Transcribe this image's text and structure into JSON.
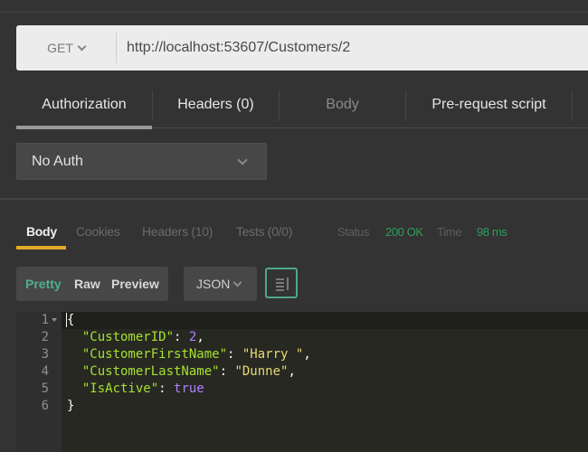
{
  "request": {
    "method": "GET",
    "url": "http://localhost:53607/Customers/2",
    "tabs": [
      {
        "label": "Authorization",
        "active": true,
        "disabled": false
      },
      {
        "label": "Headers (0)",
        "active": false,
        "disabled": false
      },
      {
        "label": "Body",
        "active": false,
        "disabled": true
      },
      {
        "label": "Pre-request script",
        "active": false,
        "disabled": false
      }
    ],
    "auth_type": "No Auth"
  },
  "response": {
    "tabs": [
      {
        "label": "Body",
        "active": true
      },
      {
        "label": "Cookies",
        "active": false
      },
      {
        "label": "Headers (10)",
        "active": false
      },
      {
        "label": "Tests (0/0)",
        "active": false
      }
    ],
    "status_label": "Status",
    "status_value": "200 OK",
    "time_label": "Time",
    "time_value": "98 ms",
    "status_color": "#2f9e5a",
    "view_modes": [
      {
        "label": "Pretty",
        "active": true
      },
      {
        "label": "Raw",
        "active": false
      },
      {
        "label": "Preview",
        "active": false
      }
    ],
    "format": "JSON",
    "wrap_icon": "wrap-lines-icon",
    "body_lines": [
      {
        "num": "1",
        "text": "{"
      },
      {
        "num": "2",
        "key": "\"CustomerID\"",
        "value": "2",
        "value_type": "number",
        "trail": ","
      },
      {
        "num": "3",
        "key": "\"CustomerFirstName\"",
        "value": "\"Harry \"",
        "value_type": "string",
        "trail": ","
      },
      {
        "num": "4",
        "key": "\"CustomerLastName\"",
        "value": "\"Dunne\"",
        "value_type": "string",
        "trail": ","
      },
      {
        "num": "5",
        "key": "\"IsActive\"",
        "value": "true",
        "value_type": "boolean",
        "trail": ""
      },
      {
        "num": "6",
        "text": "}"
      }
    ]
  },
  "colors": {
    "accent_tab": "#e0a928",
    "pretty_active": "#51b08c",
    "json_key": "#a6e22e",
    "json_string": "#e6db74",
    "json_number": "#ae81ff"
  }
}
